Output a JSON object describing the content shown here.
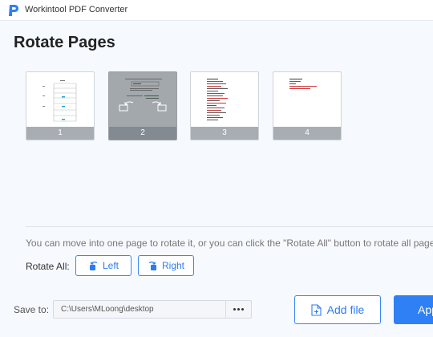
{
  "app": {
    "title": "Workintool PDF Converter",
    "logo_icon": "pdf-p-logo",
    "brand_color": "#2f7ff5"
  },
  "page": {
    "title": "Rotate Pages"
  },
  "pages": [
    {
      "number": "1",
      "selected": false
    },
    {
      "number": "2",
      "selected": true
    },
    {
      "number": "3",
      "selected": false
    },
    {
      "number": "4",
      "selected": false
    }
  ],
  "hint": "You can move into one page to rotate it, or you can click the \"Rotate All\" button to rotate all pages.",
  "rotate_all": {
    "label": "Rotate All:",
    "left_label": "Left",
    "right_label": "Right",
    "left_icon": "rotate-left-icon",
    "right_icon": "rotate-right-icon"
  },
  "save": {
    "label": "Save to:",
    "path": "C:\\Users\\MLoong\\desktop",
    "browse_icon": "ellipsis-icon"
  },
  "actions": {
    "add_file_label": "Add file",
    "add_file_icon": "file-plus-icon",
    "apply_label": "Apply"
  }
}
